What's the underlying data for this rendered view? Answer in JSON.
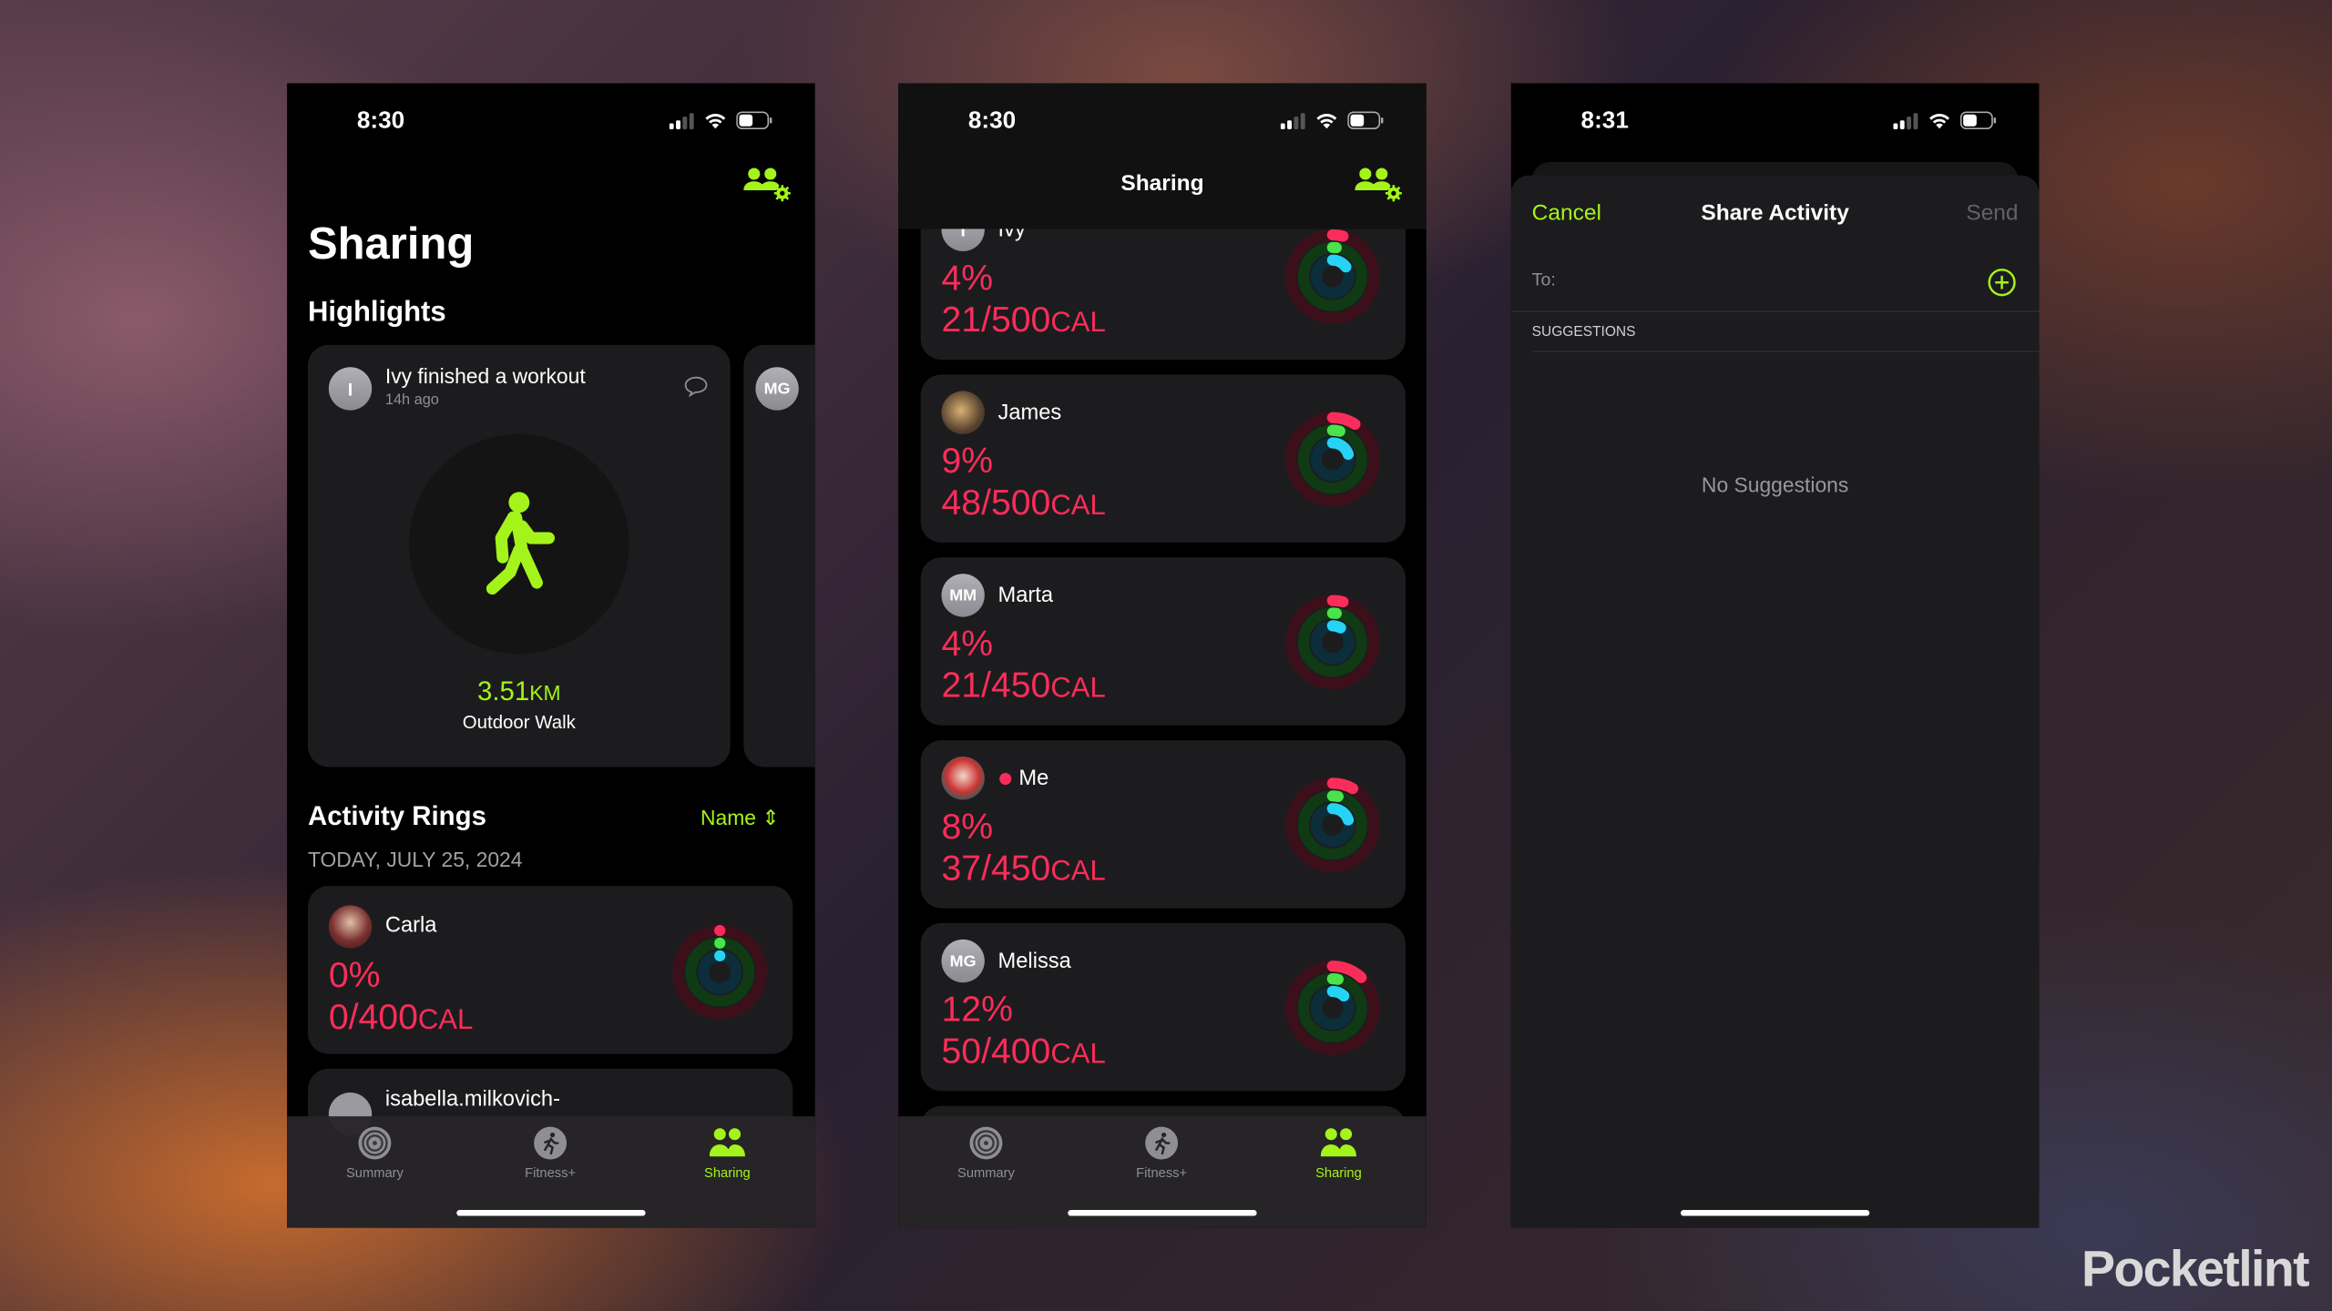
{
  "colors": {
    "accent": "#a4f41b",
    "move": "#fa2d5a",
    "exercise": "#4be34b",
    "stand": "#27d3f5",
    "card": "#1c1c1e"
  },
  "phone1": {
    "time": "8:30",
    "title": "Sharing",
    "highlights_title": "Highlights",
    "highlight": {
      "avatar": "I",
      "text": "Ivy finished a workout",
      "time": "14h ago",
      "distance": "3.51",
      "distance_unit": "KM",
      "workout": "Outdoor Walk",
      "icon": "walking-figure-icon"
    },
    "next_highlight_avatar": "MG",
    "rings_title": "Activity Rings",
    "sort_label": "Name",
    "date": "TODAY, JULY 25, 2024",
    "friends": [
      {
        "name": "Carla",
        "pct": "0%",
        "cal": "0/400",
        "unit": "CAL",
        "move": 0,
        "exercise": 0,
        "stand": 0
      },
      {
        "name": "isabella.milkovich-"
      }
    ]
  },
  "phone2": {
    "time": "8:30",
    "nav_title": "Sharing",
    "friends": [
      {
        "name": "Ivy",
        "avatar": "I",
        "pct": "4%",
        "cal": "21/500",
        "unit": "CAL",
        "move": 0.04,
        "exercise": 0.02,
        "stand": 0.15
      },
      {
        "name": "James",
        "pct": "9%",
        "cal": "48/500",
        "unit": "CAL",
        "move": 0.09,
        "exercise": 0.04,
        "stand": 0.2
      },
      {
        "name": "Marta",
        "avatar": "MM",
        "pct": "4%",
        "cal": "21/450",
        "unit": "CAL",
        "move": 0.04,
        "exercise": 0.02,
        "stand": 0.08
      },
      {
        "name": "Me",
        "pct": "8%",
        "cal": "37/450",
        "unit": "CAL",
        "move": 0.08,
        "exercise": 0.03,
        "stand": 0.2
      },
      {
        "name": "Melissa",
        "avatar": "MG",
        "pct": "12%",
        "cal": "50/400",
        "unit": "CAL",
        "move": 0.12,
        "exercise": 0.03,
        "stand": 0.12
      }
    ]
  },
  "phone3": {
    "time": "8:31",
    "cancel": "Cancel",
    "title": "Share Activity",
    "send": "Send",
    "to_label": "To:",
    "suggestions_header": "SUGGESTIONS",
    "empty": "No Suggestions"
  },
  "tabs": [
    {
      "label": "Summary",
      "icon": "activity-rings-icon"
    },
    {
      "label": "Fitness+",
      "icon": "fitness-runner-icon"
    },
    {
      "label": "Sharing",
      "icon": "people-icon",
      "active": true
    }
  ],
  "watermark": "Pocketlint"
}
